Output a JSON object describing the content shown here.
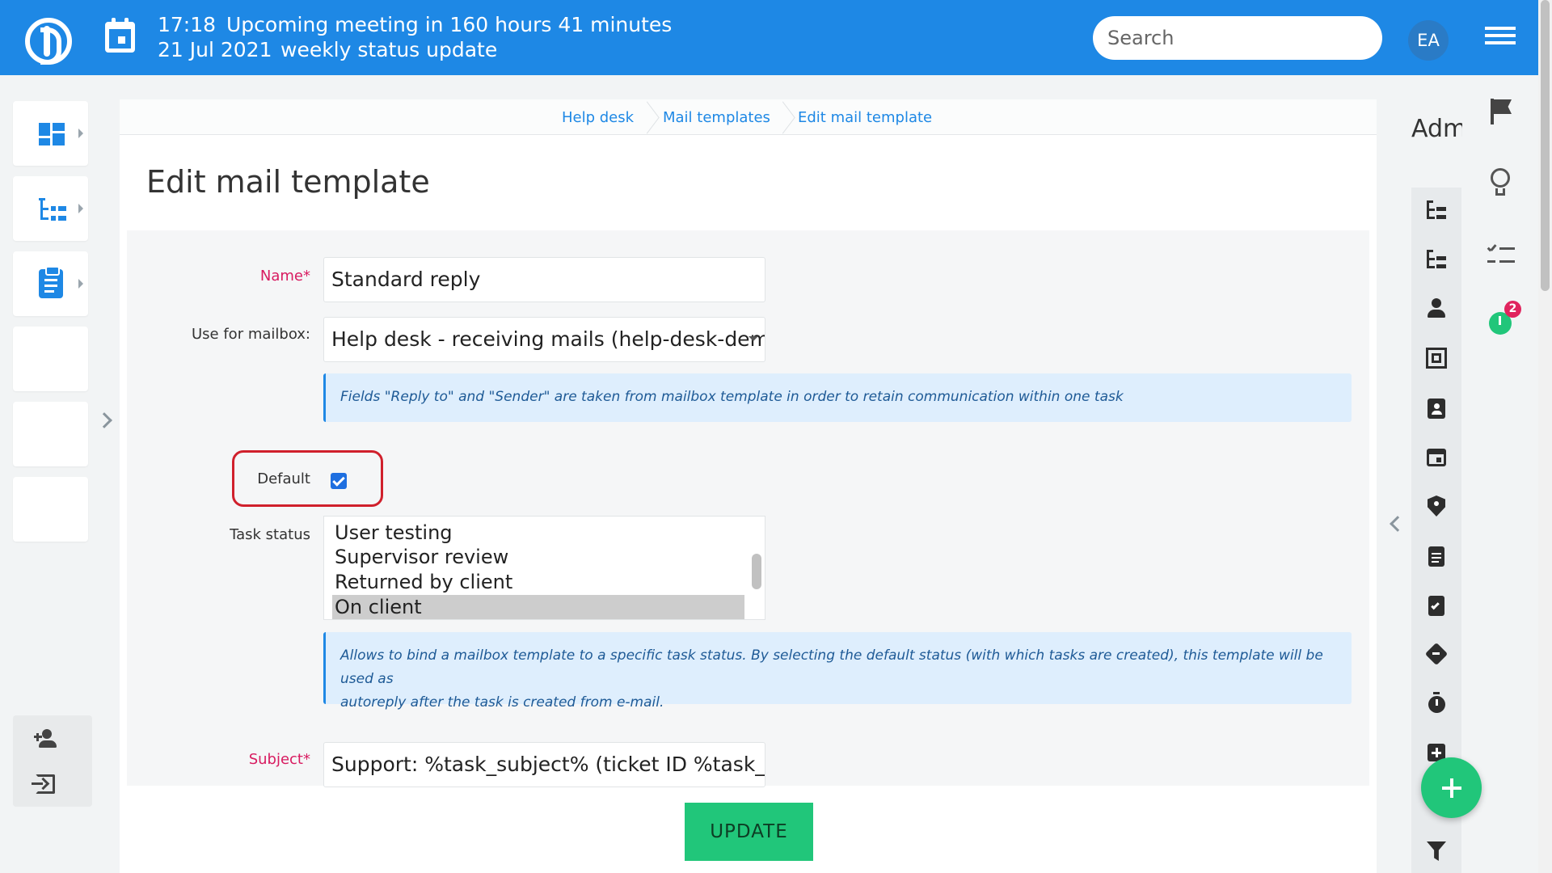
{
  "header": {
    "time": "17:18",
    "meeting_text": "Upcoming meeting in 160 hours 41 minutes",
    "date": "21 Jul 2021",
    "meeting_title": "weekly status update",
    "search_placeholder": "Search",
    "user_initials": "EA"
  },
  "breadcrumb": [
    "Help desk",
    "Mail templates",
    "Edit mail template"
  ],
  "page": {
    "title": "Edit mail template"
  },
  "form": {
    "name_label": "Name*",
    "name_value": "Standard reply",
    "mailbox_label": "Use for mailbox:",
    "mailbox_value": "Help desk - receiving mails (help-desk-demo@",
    "mailbox_info": "Fields \"Reply to\" and \"Sender\" are taken from mailbox template in order to retain communication within one task",
    "default_label": "Default",
    "default_checked": true,
    "task_status_label": "Task status",
    "task_status_options": [
      "User testing",
      "Supervisor review",
      "Returned by client",
      "On client"
    ],
    "task_status_selected": "On client",
    "task_status_info_line1": "Allows to bind a mailbox template to a specific task status. By selecting the default status (with which tasks are created), this template will be used as",
    "task_status_info_line2": "autoreply after the task is created from e-mail.",
    "subject_label": "Subject*",
    "subject_value": "Support: %task_subject% (ticket ID %task_id%)",
    "update_label": "UPDATE"
  },
  "right_panel": {
    "title": "Admin",
    "notification_count": "2"
  },
  "colors": {
    "header_bg": "#1e88e5",
    "accent_green": "#21c67a",
    "required_label": "#d81b60",
    "highlight_ring": "#d0202c"
  }
}
